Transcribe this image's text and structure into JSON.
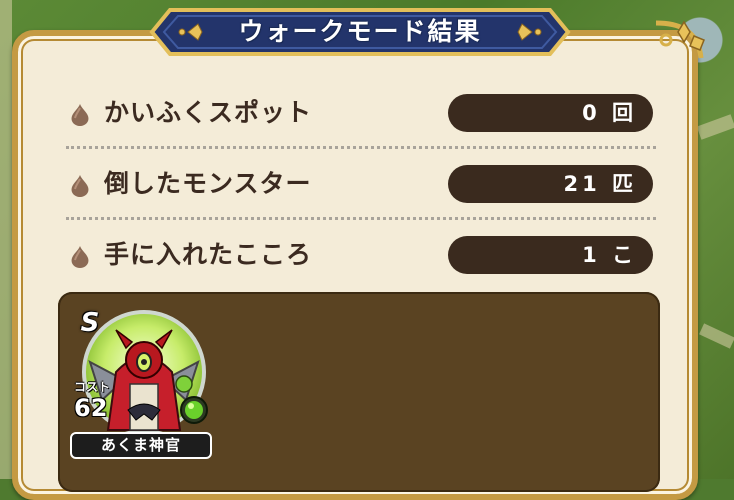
{
  "title": "ウォークモード結果",
  "rows": [
    {
      "label": "かいふくスポット",
      "value": "0 回",
      "icon": "bulb-icon"
    },
    {
      "label": "倒したモンスター",
      "value": "21 匹",
      "icon": "bulb-icon"
    },
    {
      "label": "手に入れたこころ",
      "value": "1 こ",
      "icon": "bulb-icon"
    }
  ],
  "heart": {
    "rank": "S",
    "cost_label": "コスト",
    "cost_value": "62",
    "name": "あくま神官",
    "icon": "demon-priest-portrait",
    "orb_color": "#6ad12b"
  },
  "colors": {
    "panel_bg": "#f4ecd8",
    "panel_border": "#c49a43",
    "banner": "#23346b",
    "pill": "#3a2a1e",
    "heart_box": "#5a4322"
  }
}
